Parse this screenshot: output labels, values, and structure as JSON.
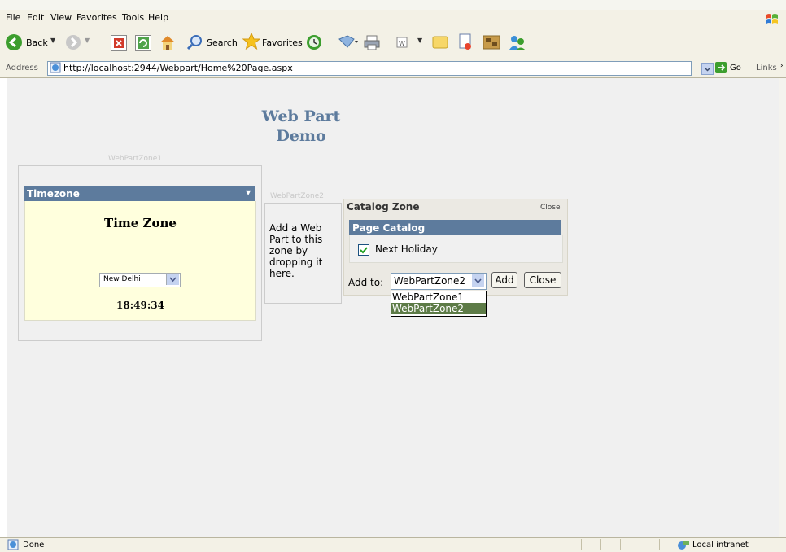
{
  "menu": [
    "File",
    "Edit",
    "View",
    "Favorites",
    "Tools",
    "Help"
  ],
  "toolbar": {
    "back_label": "Back",
    "search_label": "Search",
    "favorites_label": "Favorites"
  },
  "address": {
    "label": "Address",
    "url": "http://localhost:2944/Webpart/Home%20Page.aspx",
    "go_label": "Go",
    "links_label": "Links"
  },
  "page": {
    "title_line1": "Web Part",
    "title_line2": "Demo"
  },
  "zone1": {
    "label": "WebPartZone1",
    "timezone_part": {
      "title": "Timezone",
      "verb_icon": "chevron-down-icon",
      "heading": "Time Zone",
      "selected_city": "New Delhi",
      "time": "18:49:34"
    }
  },
  "zone2": {
    "label": "WebPartZone2",
    "empty_text": "Add a Web Part to this zone by dropping it here."
  },
  "catalog": {
    "title": "Catalog Zone",
    "close_link": "Close",
    "page_catalog_title": "Page Catalog",
    "item": "Next Holiday",
    "item_checked": true,
    "add_to_label": "Add to:",
    "add_to_value": "WebPartZone2",
    "options": [
      "WebPartZone1",
      "WebPartZone2"
    ],
    "add_button": "Add",
    "close_button": "Close"
  },
  "status": {
    "text": "Done",
    "zone": "Local intranet"
  },
  "colors": {
    "part_header": "#5d7b9d",
    "part_body": "#ffffdd",
    "dropdown_highlight": "#5d7b47"
  }
}
